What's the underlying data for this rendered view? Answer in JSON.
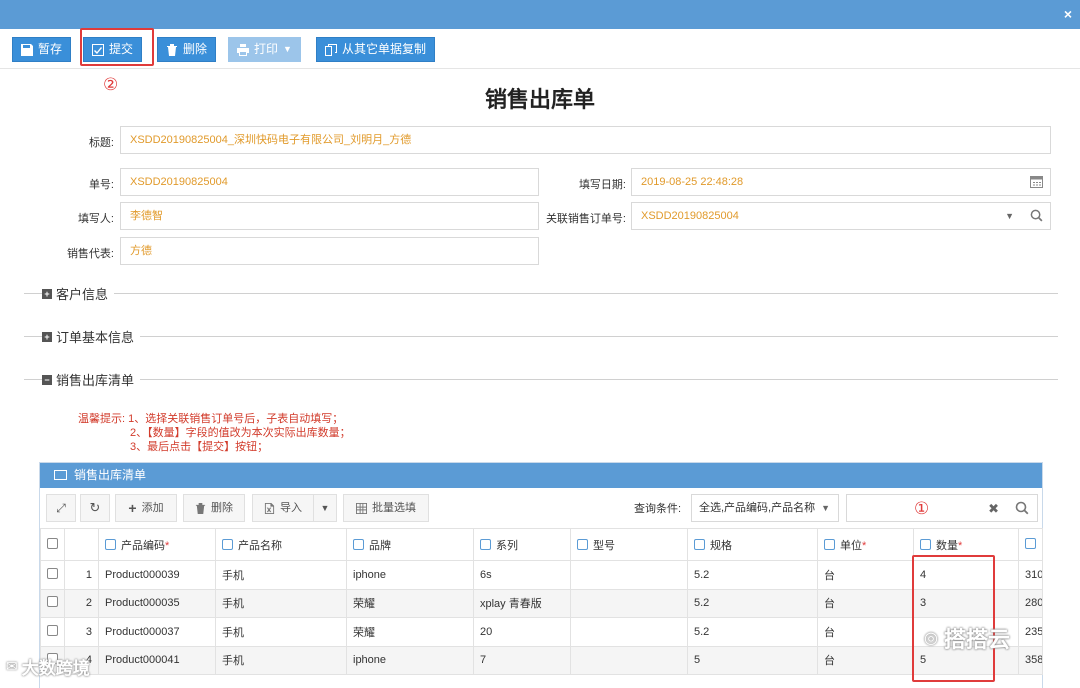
{
  "window": {
    "close_glyph": "×"
  },
  "toolbar": {
    "save_draft": "暂存",
    "submit": "提交",
    "delete": "删除",
    "print": "打印",
    "copy_from": "从其它单据复制"
  },
  "annotations": {
    "marker_1": "①",
    "marker_2": "②"
  },
  "form": {
    "title": "销售出库单",
    "fields": {
      "subject_label": "标题:",
      "subject_value": "XSDD20190825004_深圳快码电子有限公司_刘明月_方德",
      "order_no_label": "单号:",
      "order_no_value": "XSDD20190825004",
      "fill_date_label": "填写日期:",
      "fill_date_value": "2019-08-25 22:48:28",
      "filler_label": "填写人:",
      "filler_value": "李德智",
      "related_order_label": "关联销售订单号:",
      "related_order_value": "XSDD20190825004",
      "sales_rep_label": "销售代表:",
      "sales_rep_value": "方德"
    }
  },
  "sections": {
    "customer_info": "客户信息",
    "order_info": "订单基本信息",
    "outbound_list": "销售出库清单",
    "collapsed_glyph": "+",
    "expanded_glyph": "−"
  },
  "tips": {
    "line1": "温馨提示: 1、选择关联销售订单号后，子表自动填写；",
    "line2": "2、【数量】字段的值改为本次实际出库数量；",
    "line3": "3、最后点击【提交】按钮；"
  },
  "grid": {
    "panel_title": "销售出库清单",
    "tools": {
      "add": "添加",
      "delete": "删除",
      "import": "导入",
      "batch_select": "批量选填"
    },
    "query_label": "查询条件:",
    "query_value": "全选,产品编码,产品名称",
    "search_value": "",
    "columns": [
      "产品编码",
      "产品名称",
      "品牌",
      "系列",
      "型号",
      "规格",
      "单位",
      "数量",
      ""
    ],
    "rows": [
      {
        "index": "1",
        "code": "Product000039",
        "name": "手机",
        "brand": "iphone",
        "series": "6s",
        "model": "",
        "spec": "5.2",
        "unit": "台",
        "qty": "4",
        "extra": "310"
      },
      {
        "index": "2",
        "code": "Product000035",
        "name": "手机",
        "brand": "荣耀",
        "series": "xplay 青春版",
        "model": "",
        "spec": "5.2",
        "unit": "台",
        "qty": "3",
        "extra": "280"
      },
      {
        "index": "3",
        "code": "Product000037",
        "name": "手机",
        "brand": "荣耀",
        "series": "20",
        "model": "",
        "spec": "5.2",
        "unit": "台",
        "qty": "",
        "extra": "235"
      },
      {
        "index": "4",
        "code": "Product000041",
        "name": "手机",
        "brand": "iphone",
        "series": "7",
        "model": "",
        "spec": "5",
        "unit": "台",
        "qty": "5",
        "extra": "358"
      }
    ]
  },
  "watermarks": {
    "left": "大数跨境",
    "right": "搭搭云"
  },
  "colors": {
    "accent": "#5b9bd5",
    "highlight": "#e03b3b",
    "field_text": "#e19a2b"
  }
}
